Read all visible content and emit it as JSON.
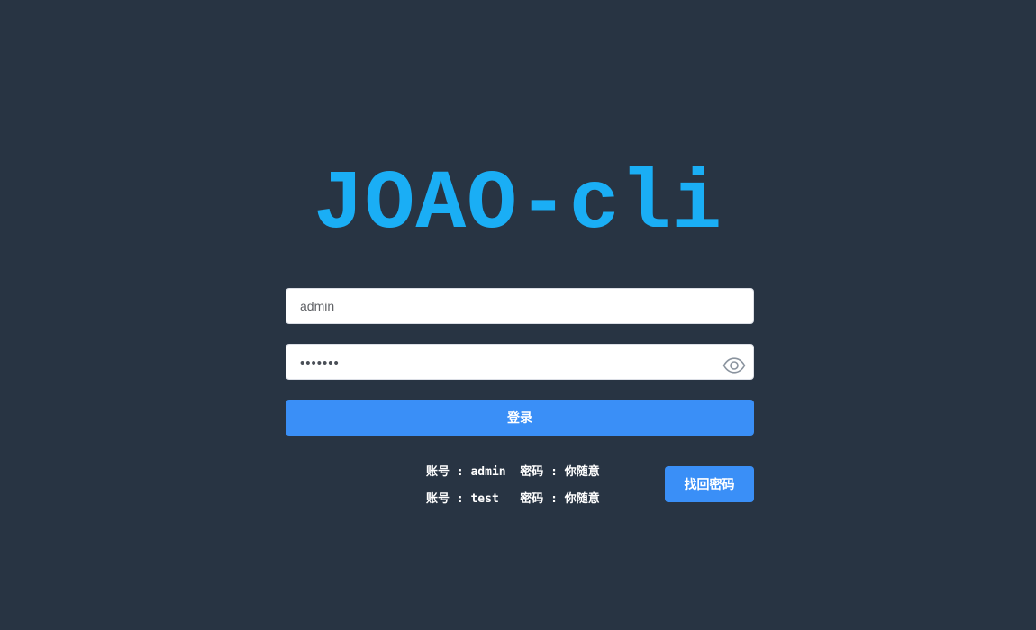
{
  "brand": {
    "title": "JOAO-cli"
  },
  "form": {
    "username": {
      "value": "admin"
    },
    "password": {
      "masked_value": "•••••••",
      "toggle_icon": "eye-icon"
    },
    "login_label": "登录"
  },
  "tips": [
    "账号 : admin  密码 : 你随意",
    "账号 : test   密码 : 你随意"
  ],
  "find_password_label": "找回密码",
  "colors": {
    "background": "#283443",
    "brand": "#1aaef5",
    "primary_button": "#3a8ff7",
    "input_background": "#ffffff"
  }
}
